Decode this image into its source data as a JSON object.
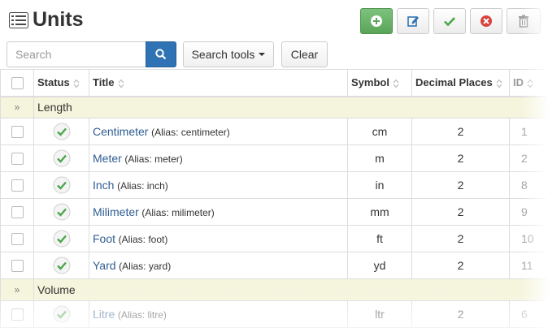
{
  "header": {
    "title": "Units"
  },
  "toolbar": {
    "new_icon": "plus-circle-icon",
    "edit_icon": "edit-icon",
    "publish_icon": "check-icon",
    "unpublish_icon": "cross-circle-icon",
    "trash_icon": "trash-icon"
  },
  "search": {
    "placeholder": "Search",
    "value": "",
    "tools_label": "Search tools",
    "clear_label": "Clear"
  },
  "columns": {
    "status": "Status",
    "title": "Title",
    "symbol": "Symbol",
    "decimal_places": "Decimal Places",
    "id": "ID"
  },
  "groups": [
    {
      "name": "Length",
      "rows": [
        {
          "title": "Centimeter",
          "alias": "(Alias: centimeter)",
          "symbol": "cm",
          "decimals": "2",
          "id": "1"
        },
        {
          "title": "Meter",
          "alias": "(Alias: meter)",
          "symbol": "m",
          "decimals": "2",
          "id": "2"
        },
        {
          "title": "Inch",
          "alias": "(Alias: inch)",
          "symbol": "in",
          "decimals": "2",
          "id": "8"
        },
        {
          "title": "Milimeter",
          "alias": "(Alias: milimeter)",
          "symbol": "mm",
          "decimals": "2",
          "id": "9"
        },
        {
          "title": "Foot",
          "alias": "(Alias: foot)",
          "symbol": "ft",
          "decimals": "2",
          "id": "10"
        },
        {
          "title": "Yard",
          "alias": "(Alias: yard)",
          "symbol": "yd",
          "decimals": "2",
          "id": "11"
        }
      ]
    },
    {
      "name": "Volume",
      "rows": [
        {
          "title": "Litre",
          "alias": "(Alias: litre)",
          "symbol": "ltr",
          "decimals": "2",
          "id": "6"
        }
      ]
    }
  ],
  "group_marker": "»",
  "colors": {
    "accent_green": "#5aa55a",
    "link_blue": "#2f5d92",
    "group_bg": "#f5f4dc",
    "search_btn": "#2f73b4"
  }
}
